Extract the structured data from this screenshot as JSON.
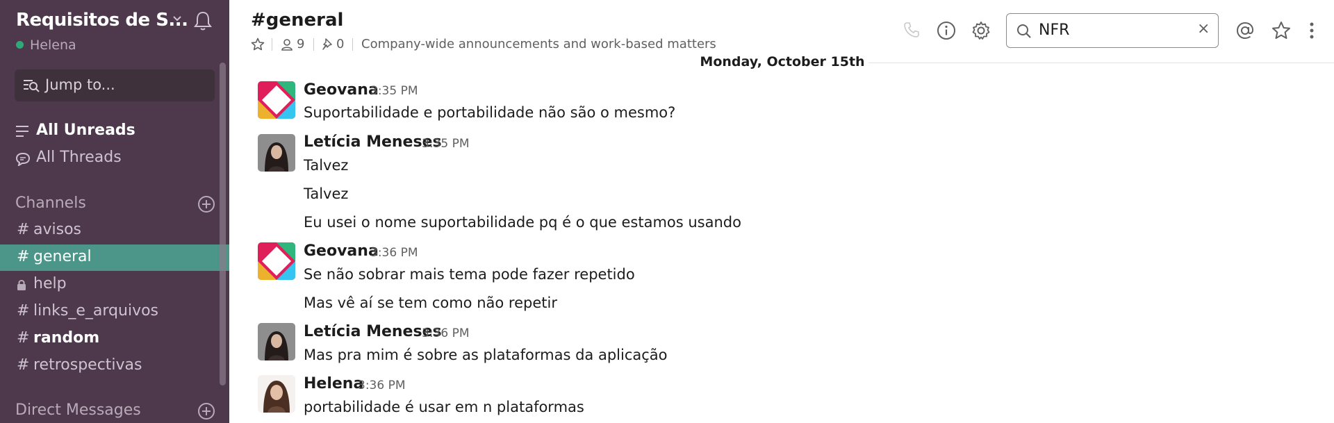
{
  "workspace": {
    "name": "Requisitos de S...",
    "user": "Helena"
  },
  "sidebar": {
    "jump_placeholder": "Jump to...",
    "all_unreads": "All Unreads",
    "all_threads": "All Threads",
    "channels_header": "Channels",
    "channels": [
      {
        "prefix": "#",
        "name": "avisos"
      },
      {
        "prefix": "#",
        "name": "general"
      },
      {
        "prefix": "lock",
        "name": "help"
      },
      {
        "prefix": "#",
        "name": "links_e_arquivos"
      },
      {
        "prefix": "#",
        "name": "random"
      },
      {
        "prefix": "#",
        "name": "retrospectivas"
      }
    ],
    "dm_header": "Direct Messages"
  },
  "header": {
    "channel": "#general",
    "members": "9",
    "pins": "0",
    "topic": "Company-wide announcements and work-based matters"
  },
  "search": {
    "value": "NFR",
    "clear": "×"
  },
  "date_divider": "Monday, October 15th",
  "messages": [
    {
      "author": "Geovana",
      "time": "3:35 PM",
      "lines": [
        "Suportabilidade e portabilidade não são o mesmo?"
      ]
    },
    {
      "author": "Letícia Meneses",
      "time": "3:35 PM",
      "lines": [
        "Talvez",
        "Talvez",
        "Eu usei o nome suportabilidade pq é o que estamos usando"
      ]
    },
    {
      "author": "Geovana",
      "time": "3:36 PM",
      "lines": [
        "Se não sobrar mais tema pode fazer repetido",
        "Mas vê aí se tem como não repetir"
      ]
    },
    {
      "author": "Letícia Meneses",
      "time": "3:36 PM",
      "lines": [
        "Mas pra mim é sobre as plataformas da aplicação"
      ]
    },
    {
      "author": "Helena",
      "time": "3:36 PM",
      "lines": [
        "portabilidade é usar em n plataformas"
      ]
    }
  ],
  "colors": {
    "sidebar": "#4d394b",
    "active_channel": "#4c9689",
    "presence": "#2bac76"
  },
  "icons": [
    "chevron-down-icon",
    "bell-icon",
    "jump-icon",
    "all-unreads-icon",
    "threads-icon",
    "add-channel-icon",
    "lock-icon",
    "star-icon",
    "members-icon",
    "pin-icon",
    "phone-icon",
    "info-icon",
    "gear-icon",
    "search-icon",
    "at-icon",
    "more-icon"
  ]
}
